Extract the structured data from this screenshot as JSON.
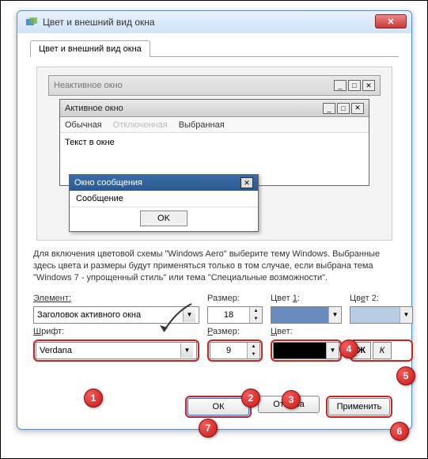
{
  "window": {
    "title": "Цвет и внешний вид окна",
    "tab": "Цвет и внешний вид окна"
  },
  "preview": {
    "inactive_title": "Неактивное окно",
    "active_title": "Активное окно",
    "menu": {
      "normal": "Обычная",
      "disabled": "Отключенная",
      "selected": "Выбранная"
    },
    "text": "Текст в окне",
    "msg_title": "Окно сообщения",
    "msg_text": "Сообщение",
    "msg_ok": "OK"
  },
  "description": "Для включения цветовой схемы \"Windows Aero\" выберите тему Windows. Выбранные здесь цвета и размеры будут применяться только в том случае, если выбрана тема \"Windows 7 - упрощенный стиль\" или тема \"Специальные возможности\".",
  "labels": {
    "element": "Элемент:",
    "size": "Размер:",
    "color1": "Цвет 1:",
    "color2": "Цвет 2:",
    "font": "Шрифт:",
    "fontsize": "Размер:",
    "fontcolor": "Цвет:"
  },
  "values": {
    "element": "Заголовок активного окна",
    "size": "18",
    "font": "Verdana",
    "fontsize": "9",
    "bold": "Ж",
    "italic": "К"
  },
  "buttons": {
    "ok": "ОК",
    "cancel": "Отмена",
    "apply": "Применить"
  },
  "badges": {
    "b1": "1",
    "b2": "2",
    "b3": "3",
    "b4": "4",
    "b5": "5",
    "b6": "6",
    "b7": "7"
  }
}
